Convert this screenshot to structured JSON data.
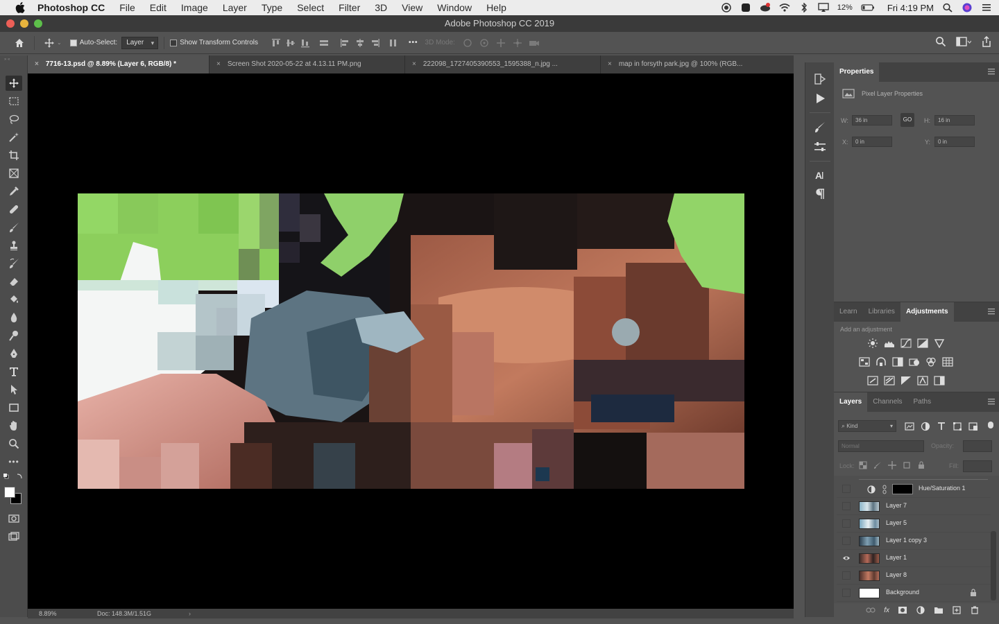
{
  "menubar": {
    "app_name": "Photoshop CC",
    "items": [
      "File",
      "Edit",
      "Image",
      "Layer",
      "Type",
      "Select",
      "Filter",
      "3D",
      "View",
      "Window",
      "Help"
    ],
    "battery": "12%",
    "clock": "Fri 4:19 PM"
  },
  "window": {
    "title": "Adobe Photoshop CC 2019"
  },
  "options": {
    "auto_select_label": "Auto-Select:",
    "auto_select_value": "Layer",
    "show_transform_label": "Show Transform Controls",
    "mode_3d_label": "3D Mode:"
  },
  "tabs": [
    {
      "label": "7716-13.psd @ 8.89% (Layer 6, RGB/8) *",
      "active": true
    },
    {
      "label": "Screen Shot 2020-05-22 at 4.13.11 PM.png",
      "active": false
    },
    {
      "label": "222098_1727405390553_1595388_n.jpg ...",
      "active": false
    },
    {
      "label": "map in forsyth park.jpg @ 100% (RGB...",
      "active": false
    }
  ],
  "status": {
    "zoom": "8.89%",
    "doc": "Doc: 148.3M/1.51G"
  },
  "properties": {
    "tab": "Properties",
    "subtitle": "Pixel Layer Properties",
    "w_label": "W:",
    "w_value": "36 in",
    "h_label": "H:",
    "h_value": "16 in",
    "x_label": "X:",
    "x_value": "0 in",
    "y_label": "Y:",
    "y_value": "0 in",
    "link_label": "GO"
  },
  "adjust_panel": {
    "tabs": [
      "Learn",
      "Libraries",
      "Adjustments"
    ],
    "active_tab": "Adjustments",
    "hint": "Add an adjustment"
  },
  "layers_panel": {
    "tabs": [
      "Layers",
      "Channels",
      "Paths"
    ],
    "active_tab": "Layers",
    "filter_label": "Kind",
    "blend_mode": "Normal",
    "opacity_label": "Opacity:",
    "lock_label": "Lock:",
    "fill_label": "Fill:",
    "layers": [
      {
        "name": "Hue/Saturation 1",
        "kind": "adjustment",
        "visible": false
      },
      {
        "name": "Layer 7",
        "kind": "pixel",
        "visible": false
      },
      {
        "name": "Layer 5",
        "kind": "pixel",
        "visible": false
      },
      {
        "name": "Layer 1 copy 3",
        "kind": "pixel",
        "visible": false
      },
      {
        "name": "Layer 1",
        "kind": "pixel",
        "visible": true
      },
      {
        "name": "Layer 8",
        "kind": "pixel",
        "visible": false
      },
      {
        "name": "Background",
        "kind": "background",
        "visible": false,
        "locked": true
      }
    ]
  },
  "colors": {
    "foreground": "#ffffff",
    "background": "#000000",
    "accent_green": "#8ccf5c",
    "accent_copper": "#b06a52",
    "accent_slate": "#5d7482"
  }
}
